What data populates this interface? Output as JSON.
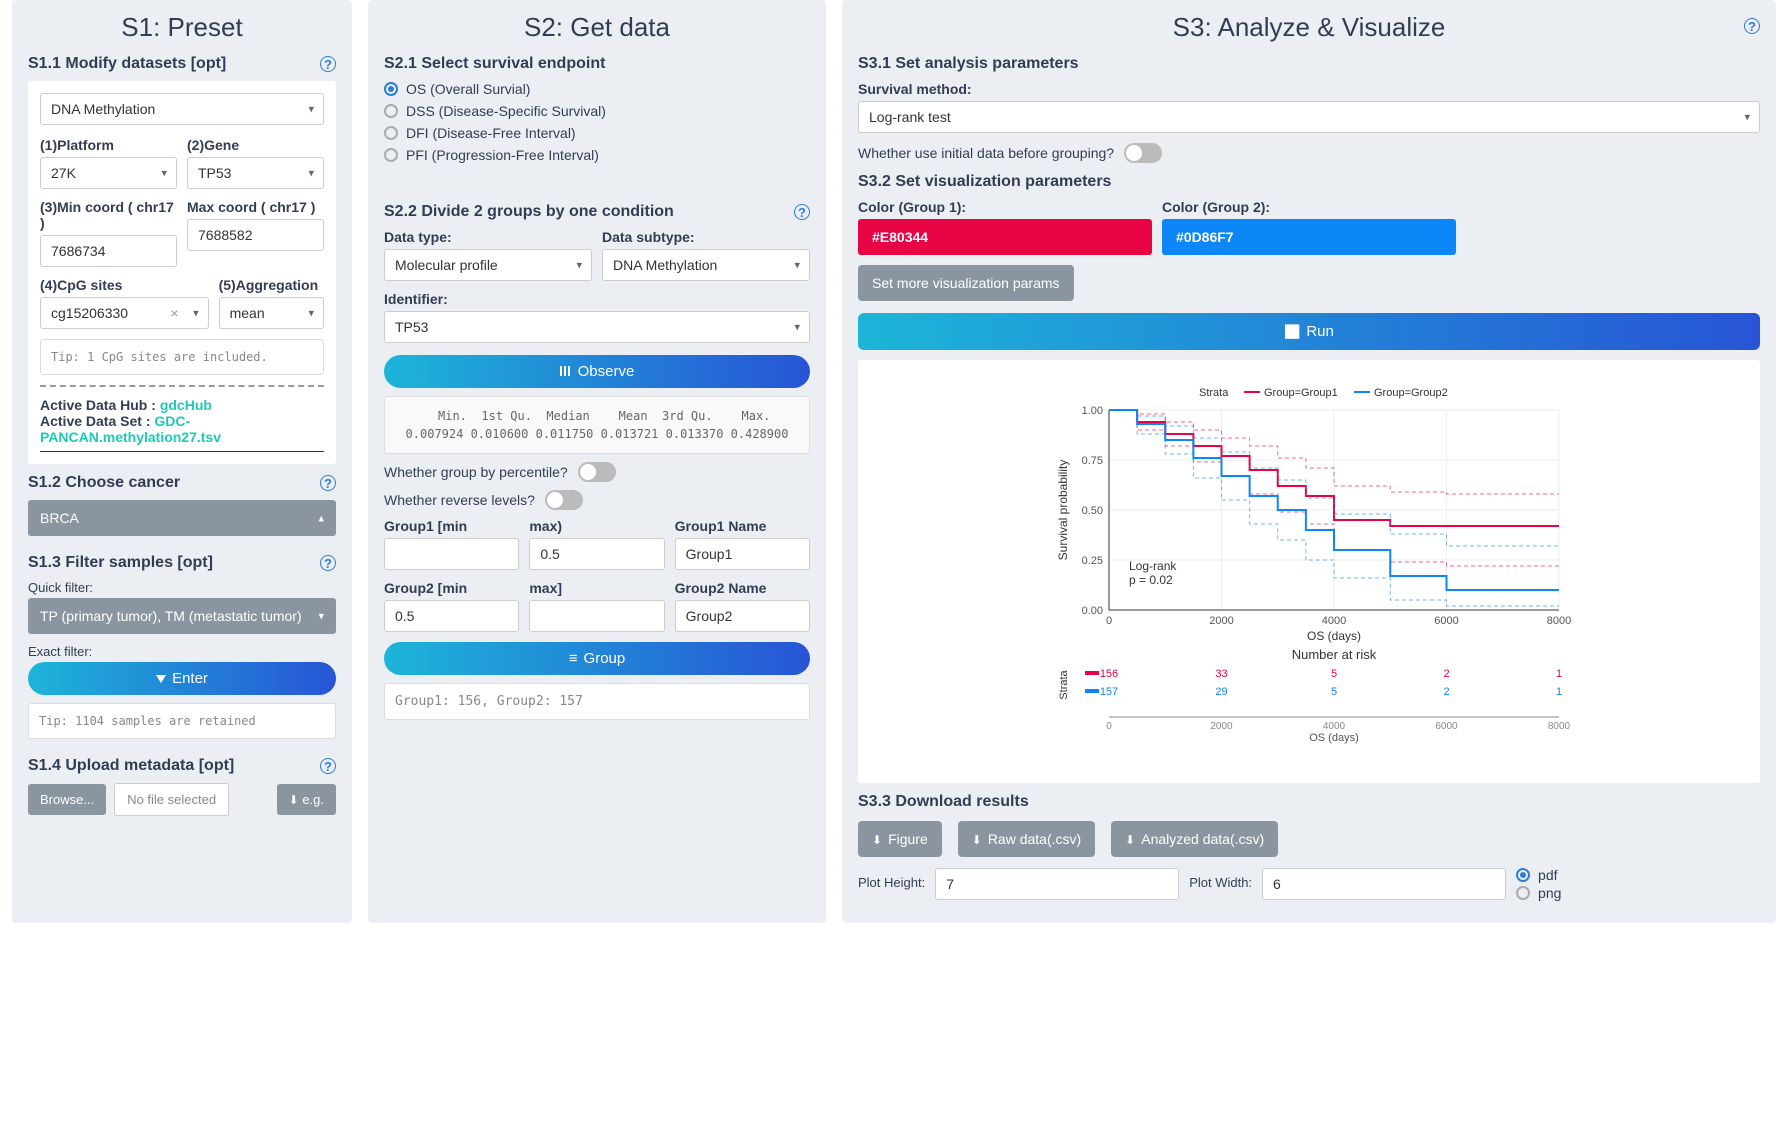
{
  "s1": {
    "title": "S1: Preset",
    "s11": {
      "title": "S1.1 Modify datasets [opt]",
      "dataset": "DNA Methylation",
      "platform_label": "(1)Platform",
      "platform": "27K",
      "gene_label": "(2)Gene",
      "gene": "TP53",
      "min_label": "(3)Min coord ( chr17 )",
      "min": "7686734",
      "max_label": "Max coord ( chr17 )",
      "max": "7688582",
      "cpg_label": "(4)CpG sites",
      "cpg": "cg15206330",
      "agg_label": "(5)Aggregation",
      "agg": "mean",
      "tip": "Tip: 1 CpG sites are included.",
      "hub_label": "Active Data Hub : ",
      "hub": "gdcHub",
      "set_label": "Active Data Set : ",
      "set": "GDC-PANCAN.methylation27.tsv"
    },
    "s12": {
      "title": "S1.2 Choose cancer",
      "value": "BRCA"
    },
    "s13": {
      "title": "S1.3 Filter samples [opt]",
      "quick_label": "Quick filter:",
      "quick_value": "TP (primary tumor), TM (metastatic tumor)",
      "exact_label": "Exact filter:",
      "enter_btn": "Enter",
      "tip": "Tip: 1104 samples are retained"
    },
    "s14": {
      "title": "S1.4 Upload metadata [opt]",
      "browse": "Browse...",
      "nofile": "No file selected",
      "eg": "e.g."
    }
  },
  "s2": {
    "title": "S2: Get data",
    "s21": {
      "title": "S2.1 Select survival endpoint",
      "options": [
        "OS (Overall Survial)",
        "DSS (Disease-Specific Survival)",
        "DFI (Disease-Free Interval)",
        "PFI (Progression-Free Interval)"
      ],
      "selected": 0
    },
    "s22": {
      "title": "S2.2 Divide 2 groups by one condition",
      "dtype_label": "Data type:",
      "dtype": "Molecular profile",
      "dsubtype_label": "Data subtype:",
      "dsubtype": "DNA Methylation",
      "ident_label": "Identifier:",
      "ident": "TP53",
      "observe_btn": "Observe",
      "stats_header": "  Min.  1st Qu.  Median    Mean  3rd Qu.    Max.",
      "stats_values": "0.007924 0.010600 0.011750 0.013721 0.013370 0.428900",
      "percentile_label": "Whether group by percentile?",
      "reverse_label": "Whether reverse levels?",
      "g1min_label": "Group1 [min",
      "g1min": "",
      "g1max_label": "max)",
      "g1max": "0.5",
      "g1name_label": "Group1 Name",
      "g1name": "Group1",
      "g2min_label": "Group2 [min",
      "g2min": "0.5",
      "g2max_label": "max]",
      "g2max": "",
      "g2name_label": "Group2 Name",
      "g2name": "Group2",
      "group_btn": "Group",
      "group_result": "Group1: 156, Group2: 157"
    }
  },
  "s3": {
    "title": "S3: Analyze & Visualize",
    "s31": {
      "title": "S3.1 Set analysis parameters",
      "method_label": "Survival method:",
      "method": "Log-rank test",
      "initial_label": "Whether use initial data before grouping?"
    },
    "s32": {
      "title": "S3.2 Set visualization parameters",
      "c1_label": "Color (Group 1):",
      "c1": "#E80344",
      "c2_label": "Color (Group 2):",
      "c2": "#0D86F7",
      "more_btn": "Set more visualization params",
      "run_btn": "Run"
    },
    "s33": {
      "title": "S3.3 Download results",
      "figure_btn": "Figure",
      "raw_btn": "Raw data(.csv)",
      "analyzed_btn": "Analyzed data(.csv)",
      "ph_label": "Plot Height:",
      "ph": "7",
      "pw_label": "Plot Width:",
      "pw": "6",
      "pdf": "pdf",
      "png": "png"
    }
  },
  "chart_data": {
    "type": "line",
    "title": "",
    "strata_label": "Strata",
    "legend": [
      "Group=Group1",
      "Group=Group2"
    ],
    "colors": [
      "#E80344",
      "#0D86F7"
    ],
    "xlabel": "OS (days)",
    "ylabel": "Survival probability",
    "xlim": [
      0,
      8000
    ],
    "ylim": [
      0,
      1.0
    ],
    "xticks": [
      0,
      2000,
      4000,
      6000,
      8000
    ],
    "yticks": [
      0.0,
      0.25,
      0.5,
      0.75,
      1.0
    ],
    "annotation": "Log-rank\np = 0.02",
    "series": [
      {
        "name": "Group1",
        "x": [
          0,
          500,
          1000,
          1500,
          2000,
          2500,
          3000,
          3500,
          4000,
          5000,
          6000,
          8000
        ],
        "y": [
          1.0,
          0.94,
          0.88,
          0.82,
          0.77,
          0.7,
          0.62,
          0.57,
          0.45,
          0.42,
          0.42,
          0.42
        ],
        "lo": [
          1.0,
          0.9,
          0.82,
          0.74,
          0.67,
          0.58,
          0.49,
          0.43,
          0.3,
          0.24,
          0.22,
          0.22
        ],
        "hi": [
          1.0,
          0.98,
          0.94,
          0.9,
          0.86,
          0.82,
          0.76,
          0.71,
          0.62,
          0.59,
          0.58,
          0.58
        ]
      },
      {
        "name": "Group2",
        "x": [
          0,
          500,
          1000,
          1500,
          2000,
          2500,
          3000,
          3500,
          4000,
          5000,
          6000,
          8000
        ],
        "y": [
          1.0,
          0.93,
          0.85,
          0.76,
          0.67,
          0.57,
          0.5,
          0.4,
          0.3,
          0.17,
          0.1,
          0.1
        ],
        "lo": [
          1.0,
          0.88,
          0.78,
          0.66,
          0.55,
          0.43,
          0.35,
          0.25,
          0.16,
          0.05,
          0.02,
          0.02
        ],
        "hi": [
          1.0,
          0.97,
          0.92,
          0.86,
          0.79,
          0.71,
          0.65,
          0.56,
          0.48,
          0.38,
          0.32,
          0.32
        ]
      }
    ],
    "risk_table": {
      "title": "Number at risk",
      "xlabel": "OS (days)",
      "x": [
        0,
        2000,
        4000,
        6000,
        8000
      ],
      "rows": [
        {
          "name": "Group1",
          "values": [
            156,
            33,
            5,
            2,
            1
          ]
        },
        {
          "name": "Group2",
          "values": [
            157,
            29,
            5,
            2,
            1
          ]
        }
      ]
    }
  }
}
